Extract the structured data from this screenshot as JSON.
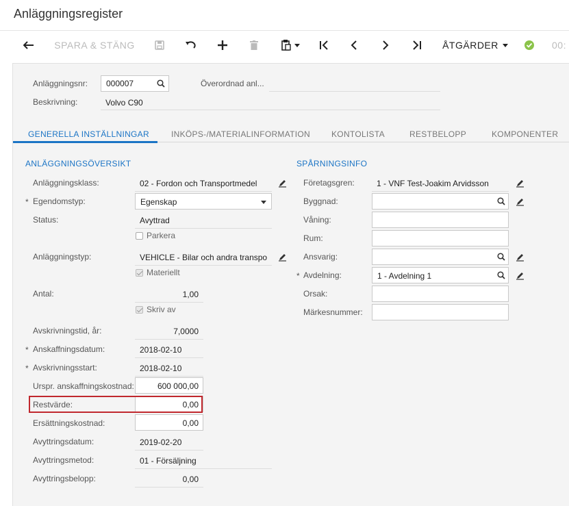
{
  "title": "Anläggningsregister",
  "toolbar": {
    "save_close": "SPARA & STÄNG",
    "actions": "ÅTGÄRDER",
    "cut_text": "00:"
  },
  "header": {
    "asset_nr_label": "Anläggningsnr:",
    "asset_nr_value": "000007",
    "parent_label": "Överordnad anl...",
    "description_label": "Beskrivning:",
    "description_value": "Volvo C90"
  },
  "tabs": [
    {
      "label": "GENERELLA INSTÄLLNINGAR",
      "active": true
    },
    {
      "label": "INKÖPS-/MATERIALINFORMATION",
      "active": false
    },
    {
      "label": "KONTOLISTA",
      "active": false
    },
    {
      "label": "RESTBELOPP",
      "active": false
    },
    {
      "label": "KOMPONENTER",
      "active": false
    }
  ],
  "overview": {
    "heading": "ANLÄGGNINGSÖVERSIKT",
    "asset_class_label": "Anläggningsklass:",
    "asset_class_value": "02 - Fordon och Transportmedel",
    "property_type_label": "Egendomstyp:",
    "property_type_value": "Egenskap",
    "status_label": "Status:",
    "status_value": "Avyttrad",
    "park_label": "Parkera",
    "asset_type_label": "Anläggningstyp:",
    "asset_type_value": "VEHICLE - Bilar och andra transpo",
    "material_label": "Materiellt",
    "quantity_label": "Antal:",
    "quantity_value": "1,00",
    "depreciate_label": "Skriv av",
    "useful_life_label": "Avskrivningstid, år:",
    "useful_life_value": "7,0000",
    "acq_date_label": "Anskaffningsdatum:",
    "acq_date_value": "2018-02-10",
    "dep_start_label": "Avskrivningsstart:",
    "dep_start_value": "2018-02-10",
    "orig_cost_label": "Urspr. anskaffningskostnad:",
    "orig_cost_value": "600 000,00",
    "salvage_label": "Restvärde:",
    "salvage_value": "0,00",
    "repl_cost_label": "Ersättningskostnad:",
    "repl_cost_value": "0,00",
    "disposal_date_label": "Avyttringsdatum:",
    "disposal_date_value": "2019-02-20",
    "disposal_method_label": "Avyttringsmetod:",
    "disposal_method_value": "01 - Försäljning",
    "disposal_amount_label": "Avyttringsbelopp:",
    "disposal_amount_value": "0,00"
  },
  "tracking": {
    "heading": "SPÅRNINGSINFO",
    "branch_label": "Företagsgren:",
    "branch_value": "1 - VNF Test-Joakim Arvidsson",
    "building_label": "Byggnad:",
    "floor_label": "Våning:",
    "room_label": "Rum:",
    "custodian_label": "Ansvarig:",
    "department_label": "Avdelning:",
    "department_value": "1 - Avdelning 1",
    "reason_label": "Orsak:",
    "tag_label": "Märkesnummer:"
  },
  "colors": {
    "accent": "#1b74c5",
    "highlight": "#c0272d",
    "check_green": "#8bc34a"
  }
}
